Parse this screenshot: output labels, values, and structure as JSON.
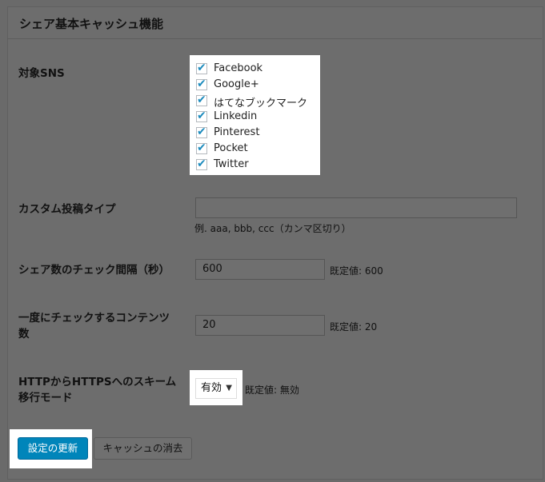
{
  "panel": {
    "title": "シェア基本キャッシュ機能"
  },
  "sns": {
    "label": "対象SNS",
    "items": [
      {
        "label": "Facebook",
        "checked": true
      },
      {
        "label": "Google+",
        "checked": true
      },
      {
        "label": "はてなブックマーク",
        "checked": true
      },
      {
        "label": "Linkedin",
        "checked": true
      },
      {
        "label": "Pinterest",
        "checked": true
      },
      {
        "label": "Pocket",
        "checked": true
      },
      {
        "label": "Twitter",
        "checked": true
      }
    ]
  },
  "custom_post": {
    "label": "カスタム投稿タイプ",
    "value": "",
    "help": "例. aaa, bbb, ccc（カンマ区切り）"
  },
  "interval": {
    "label": "シェア数のチェック間隔（秒）",
    "value": "600",
    "default": "既定値: 600"
  },
  "batch": {
    "label_line1": "一度にチェックするコンテンツ",
    "label_line2": "数",
    "value": "20",
    "default": "既定値: 20"
  },
  "migration": {
    "label_line1": "HTTPからHTTPSへのスキーム",
    "label_line2": "移行モード",
    "selected": "有効",
    "default": "既定値: 無効"
  },
  "buttons": {
    "update": "設定の更新",
    "clear_cache": "キャッシュの消去"
  },
  "colors": {
    "overlay": "#6a6a6a",
    "primary": "#0085ba",
    "checkmark": "#1e8cbe"
  }
}
